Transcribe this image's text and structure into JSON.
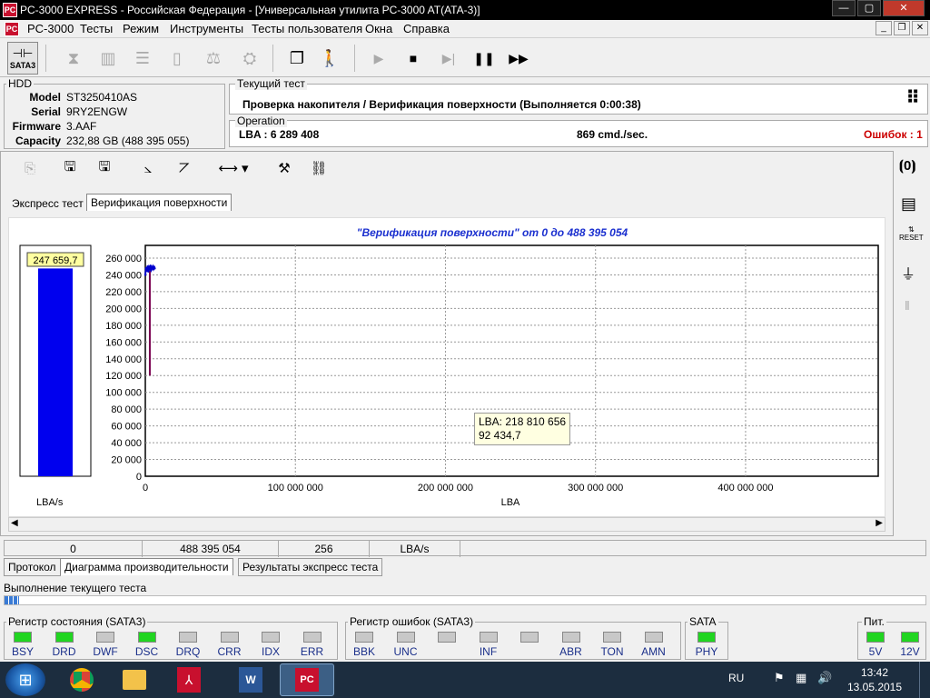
{
  "window": {
    "title": "PC-3000 EXPRESS - Российская Федерация - [Универсальная утилита PC-3000 AT(ATA-3)]",
    "icon_text": "PC",
    "controls": {
      "min": "—",
      "max": "▢",
      "close": "✕"
    }
  },
  "menu": {
    "items": [
      "PC-3000",
      "Тесты",
      "Режим",
      "Инструменты",
      "Тесты пользователя",
      "Окна",
      "Справка"
    ],
    "mdi": {
      "min": "_",
      "restore": "❐",
      "close": "✕"
    }
  },
  "toolbar": {
    "sata_label": "SATA3"
  },
  "hdd": {
    "group": "HDD",
    "fields": [
      {
        "k": "Model",
        "v": "ST3250410AS"
      },
      {
        "k": "Serial",
        "v": "9RY2ENGW"
      },
      {
        "k": "Firmware",
        "v": "3.AAF"
      },
      {
        "k": "Capacity",
        "v": "232,88 GB (488 395 055)"
      }
    ]
  },
  "current_test": {
    "group": "Текущий тест",
    "text": "Проверка накопителя / Верификация поверхности (Выполняется 0:00:38)"
  },
  "operation": {
    "group": "Operation",
    "lba": "LBA : 6 289 408",
    "rate": "869 cmd./sec.",
    "errors": "Ошибок : 1",
    "error_color": "#cc0000"
  },
  "tabs": {
    "express": "Экспресс тест",
    "verify": "Верификация поверхности"
  },
  "chart_data": {
    "type": "line",
    "title": "\"Верификация поверхности\" от 0 до 488 395 054",
    "xlabel": "LBA",
    "ylabel": "",
    "xlim": [
      0,
      488395054
    ],
    "ylim": [
      0,
      260000
    ],
    "x_ticks": [
      "0",
      "100 000 000",
      "200 000 000",
      "300 000 000",
      "400 000 000"
    ],
    "y_ticks": [
      "0",
      "20 000",
      "40 000",
      "60 000",
      "80 000",
      "100 000",
      "120 000",
      "140 000",
      "160 000",
      "180 000",
      "200 000",
      "220 000",
      "240 000",
      "260 000"
    ],
    "series": [
      {
        "color": "#0000cc",
        "x": [
          0,
          500000,
          1000000,
          1500000,
          2000000,
          2500000,
          3000000,
          3500000,
          4000000,
          4500000,
          5000000,
          5500000,
          6000000,
          6289408
        ],
        "y": [
          240000,
          248000,
          245000,
          250000,
          244000,
          249000,
          247000,
          251000,
          246000,
          248000,
          250000,
          247000,
          249000,
          247659
        ]
      }
    ],
    "error_marker": {
      "x": 3000000,
      "y_from": 120000,
      "y_to": 245000,
      "color": "#7a0050"
    },
    "bar": {
      "value": 247659.7,
      "label": "247 659,7",
      "unit": "LBA/s",
      "ymax": 260000,
      "color": "#0000ee"
    },
    "tooltip": {
      "line1": "LBA: 218 810 656",
      "line2": "92 434,7"
    }
  },
  "status_row": [
    "0",
    "488 395 054",
    "256",
    "LBA/s"
  ],
  "bottom_tabs": [
    "Протокол",
    "Диаграмма производительности",
    "Результаты экспресс теста"
  ],
  "progress_label": "Выполнение текущего теста",
  "registers": {
    "state": {
      "title": "Регистр состояния (SATA3)",
      "leds": [
        {
          "n": "BSY",
          "s": "on"
        },
        {
          "n": "DRD",
          "s": "on"
        },
        {
          "n": "DWF",
          "s": "off"
        },
        {
          "n": "DSC",
          "s": "on"
        },
        {
          "n": "DRQ",
          "s": "off"
        },
        {
          "n": "CRR",
          "s": "off"
        },
        {
          "n": "IDX",
          "s": "off"
        },
        {
          "n": "ERR",
          "s": "off"
        }
      ]
    },
    "errors": {
      "title": "Регистр ошибок (SATA3)",
      "leds": [
        {
          "n": "BBK",
          "s": "off"
        },
        {
          "n": "UNC",
          "s": "off"
        },
        {
          "n": "",
          "s": "off"
        },
        {
          "n": "INF",
          "s": "off"
        },
        {
          "n": "",
          "s": "off"
        },
        {
          "n": "ABR",
          "s": "off"
        },
        {
          "n": "TON",
          "s": "off"
        },
        {
          "n": "AMN",
          "s": "off"
        }
      ]
    },
    "sata": {
      "title": "SATA",
      "leds": [
        {
          "n": "PHY",
          "s": "on"
        }
      ]
    },
    "power": {
      "title": "Пит.",
      "leds": [
        {
          "n": "5V",
          "s": "on"
        },
        {
          "n": "12V",
          "s": "on"
        }
      ]
    }
  },
  "taskbar": {
    "lang": "RU",
    "time": "13:42",
    "date": "13.05.2015"
  }
}
